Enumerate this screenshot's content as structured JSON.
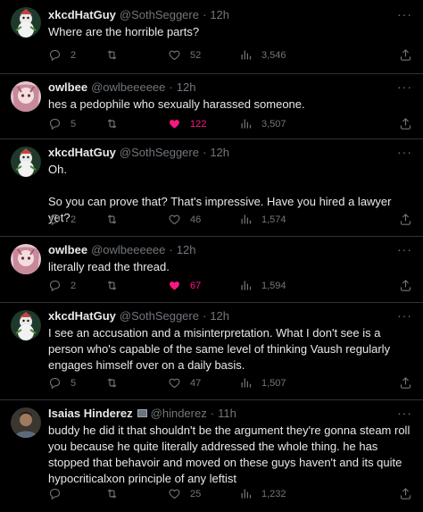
{
  "tweets": [
    {
      "name": "xkcdHatGuy",
      "handle": "@SothSeggere",
      "time": "12h",
      "text": "Where are the horrible parts?",
      "replies": "2",
      "retweets": "",
      "likes": "52",
      "views": "3,546",
      "liked": false
    },
    {
      "name": "owlbee",
      "handle": "@owlbeeeeee",
      "time": "12h",
      "text": "hes a pedophile who sexually harassed someone.",
      "replies": "5",
      "retweets": "",
      "likes": "122",
      "views": "3,507",
      "liked": true
    },
    {
      "name": "xkcdHatGuy",
      "handle": "@SothSeggere",
      "time": "12h",
      "text": "Oh.\n\nSo you can prove that? That's impressive. Have you hired a lawyer yet?",
      "replies": "2",
      "retweets": "",
      "likes": "46",
      "views": "1,574",
      "liked": false
    },
    {
      "name": "owlbee",
      "handle": "@owlbeeeeee",
      "time": "12h",
      "text": "literally read the thread.",
      "replies": "2",
      "retweets": "",
      "likes": "67",
      "views": "1,594",
      "liked": true
    },
    {
      "name": "xkcdHatGuy",
      "handle": "@SothSeggere",
      "time": "12h",
      "text": "I see an accusation and a misinterpretation. What I don't see is a person who's capable of the same level of thinking Vaush regularly engages himself over on a daily basis.",
      "replies": "5",
      "retweets": "",
      "likes": "47",
      "views": "1,507",
      "liked": false
    },
    {
      "name": "Isaias Hinderez",
      "handle": "@hinderez",
      "time": "11h",
      "text": "buddy he did it that shouldn't be the argument they're gonna steam roll you because he quite literally addressed the whole thing. he has stopped that behavoir and moved on these guys haven't and its quite hypocriticalxon principle of any leftist",
      "replies": "",
      "retweets": "",
      "likes": "25",
      "views": "1,232",
      "liked": false
    }
  ],
  "ui": {
    "more": "···",
    "dot": "·"
  },
  "colors": {
    "like_active": "#f91880",
    "muted": "#71767b"
  }
}
